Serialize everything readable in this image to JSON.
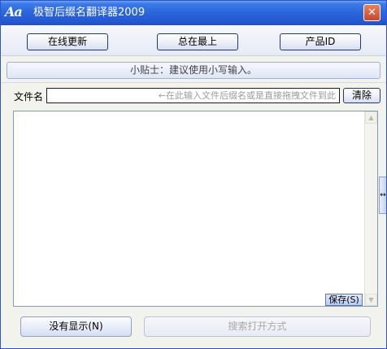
{
  "window": {
    "title": "极智后缀名翻译器2009",
    "app_icon_text": "Aa",
    "close_glyph": "✕",
    "colors": {
      "titlebar": "#2458d2",
      "window_bg": "#f3f3ee",
      "button_border": "#1f3a7a"
    }
  },
  "toolbar": {
    "online_update_label": "在线更新",
    "always_on_top_label": "总在最上",
    "product_id_label": "产品ID"
  },
  "tip": {
    "text": "小贴士：建议使用小写输入。"
  },
  "filename": {
    "label": "文件名",
    "value": "",
    "placeholder": "←在此输入文件后缀名或是直接拖拽文件到此",
    "clear_label": "清除"
  },
  "result": {
    "value": "",
    "save_label": "保存(S)",
    "scroll_up_glyph": "▲",
    "scroll_down_glyph": "▼"
  },
  "side_handle": {
    "glyph": "↔"
  },
  "footer": {
    "no_show_label": "没有显示(N)",
    "search_open_label": "搜索打开方式"
  }
}
